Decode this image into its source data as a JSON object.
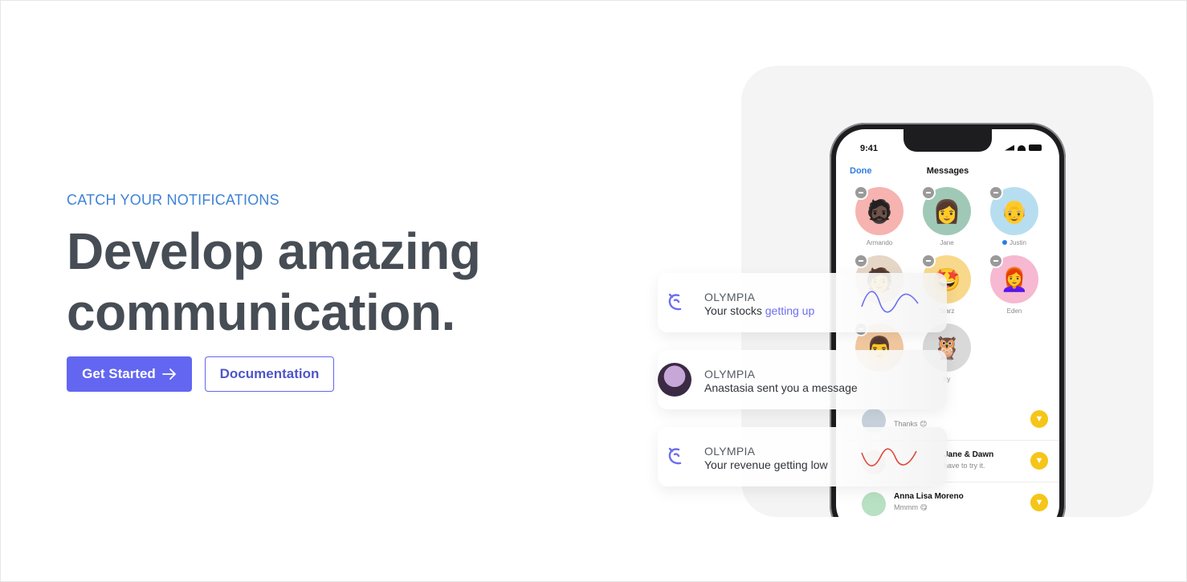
{
  "hero": {
    "eyebrow": "CATCH YOUR NOTIFICATIONS",
    "headline_line1": "Develop amazing",
    "headline_line2": "communication.",
    "primary_button": "Get Started",
    "secondary_button": "Documentation"
  },
  "phone": {
    "time": "9:41",
    "done": "Done",
    "title": "Messages",
    "avatars": [
      {
        "name": "Armando",
        "emoji": "🧔🏿"
      },
      {
        "name": "Jane",
        "emoji": "👩"
      },
      {
        "name": "Justin",
        "emoji": "👴"
      },
      {
        "name": "",
        "emoji": "🧑"
      },
      {
        "name": "Starz",
        "emoji": "🤩"
      },
      {
        "name": "Eden",
        "emoji": "👩‍🦰"
      },
      {
        "name": "",
        "emoji": "👨"
      },
      {
        "name": "tty",
        "emoji": "🦉"
      }
    ],
    "chats": [
      {
        "name": "",
        "preview": "Thanks 😊"
      },
      {
        "name": "Jane & Dawn",
        "preview": "have to try it."
      },
      {
        "name": "Anna Lisa Moreno",
        "preview": "Mmmm 😋"
      }
    ]
  },
  "notifications": [
    {
      "app": "OLYMPIA",
      "text_prefix": "Your stocks ",
      "text_highlight": "getting up",
      "icon": "olympia-logo-icon",
      "wave_color": "#6c6ef0"
    },
    {
      "app": "OLYMPIA",
      "text_prefix": "Anastasia sent you a message",
      "text_highlight": "",
      "icon": "avatar",
      "wave_color": ""
    },
    {
      "app": "OLYMPIA",
      "text_prefix": "Your revenue getting low",
      "text_highlight": "",
      "icon": "olympia-logo-icon",
      "wave_color": "#e0483e"
    }
  ],
  "colors": {
    "accent": "#6366f1",
    "eyebrow": "#3f82d6",
    "headline": "#474d55"
  }
}
